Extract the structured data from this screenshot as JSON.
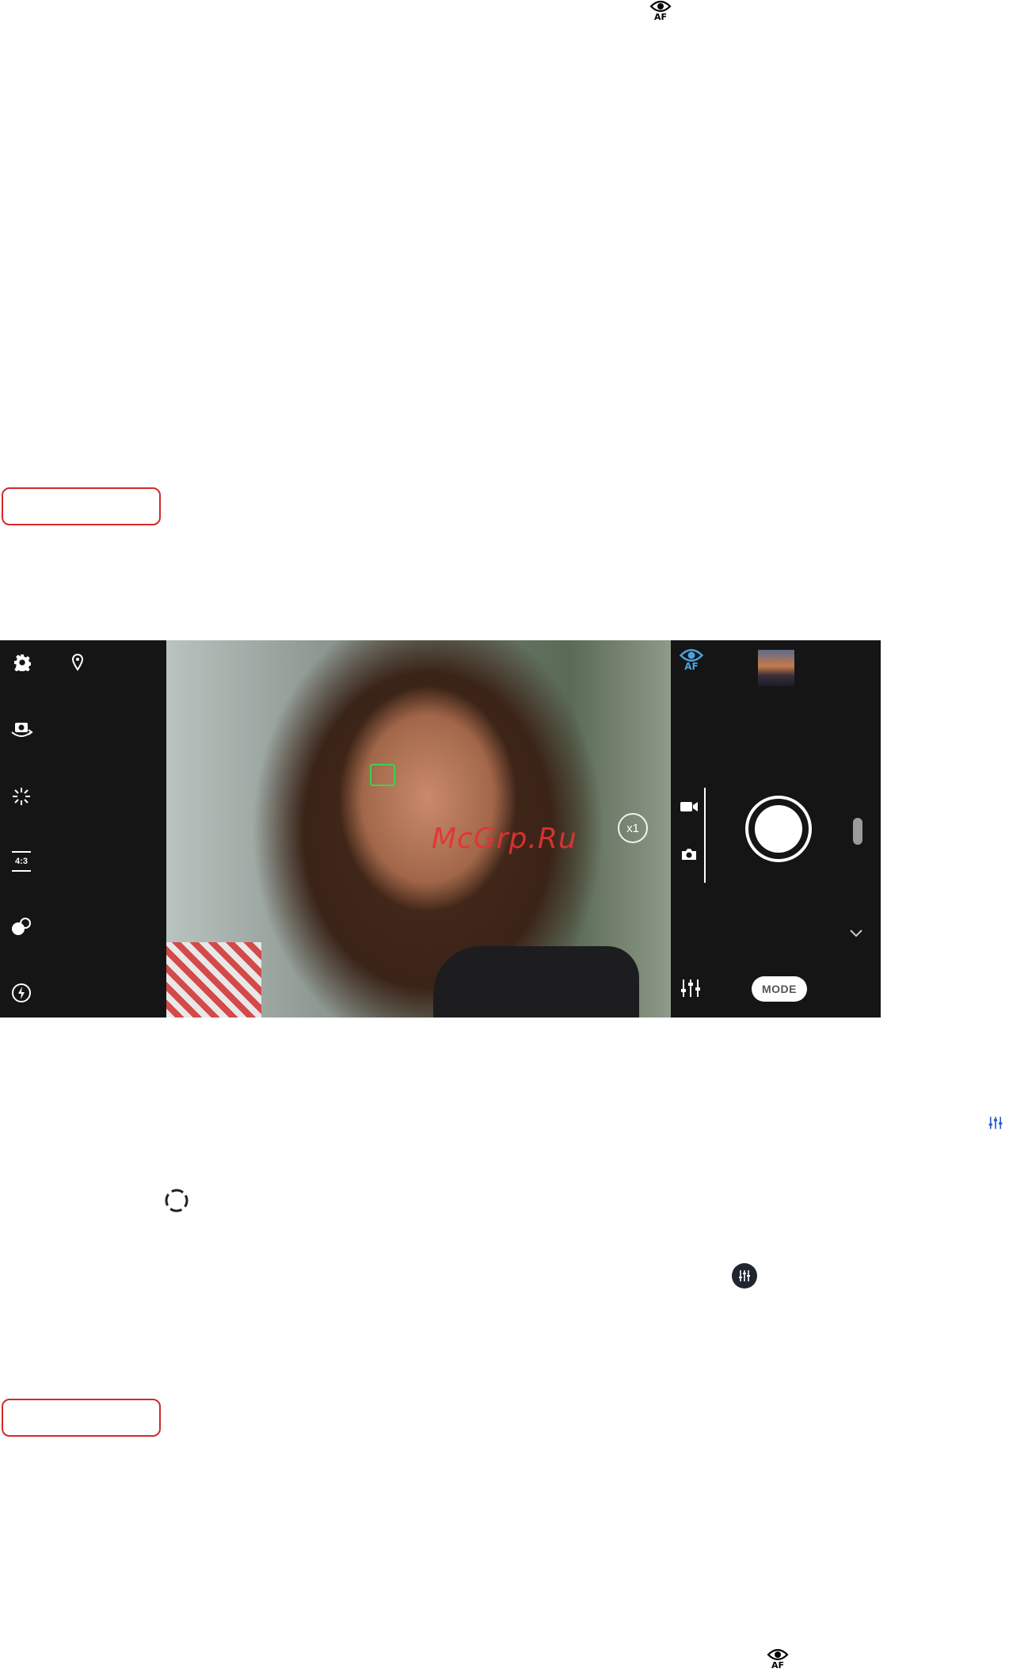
{
  "top_icon": {
    "name": "eye-af-icon",
    "af_label": "AF"
  },
  "camera": {
    "left_toolbar": [
      {
        "icon": "gear-icon"
      },
      {
        "icon": "location-icon"
      },
      {
        "icon": "switch-camera-icon"
      },
      {
        "icon": "brightness-icon"
      },
      {
        "icon": "aspect-ratio-icon",
        "label": "4:3"
      },
      {
        "icon": "bokeh-icon"
      },
      {
        "icon": "flash-icon"
      }
    ],
    "eye_af_label": "AF",
    "zoom_label": "x1",
    "mode_label": "MODE",
    "focus_color": "#3fd04f"
  },
  "watermark": "McGrp.Ru",
  "bottom_icon": {
    "name": "eye-af-icon",
    "af_label": "AF"
  },
  "colors": {
    "accent": "#4aa3df",
    "warning": "#d32a2a"
  }
}
